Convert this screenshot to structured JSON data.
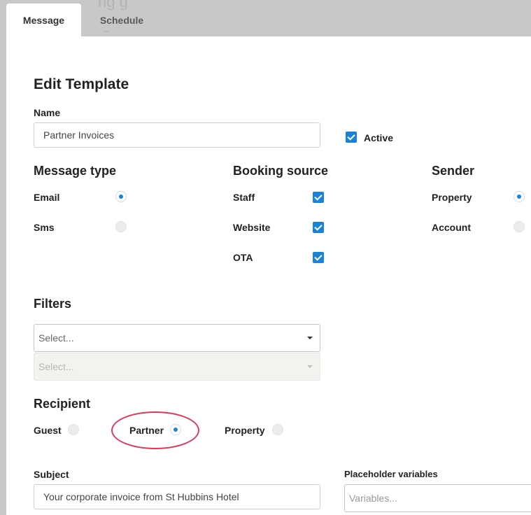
{
  "tabs": [
    {
      "label": "Message"
    },
    {
      "label": "Schedule"
    }
  ],
  "heading": "Edit Template",
  "name": {
    "label": "Name",
    "value": "Partner Invoices"
  },
  "active": {
    "label": "Active",
    "checked": true
  },
  "message_type": {
    "title": "Message type",
    "options": [
      {
        "label": "Email",
        "selected": true
      },
      {
        "label": "Sms",
        "selected": false
      }
    ]
  },
  "booking_source": {
    "title": "Booking source",
    "options": [
      {
        "label": "Staff",
        "checked": true
      },
      {
        "label": "Website",
        "checked": true
      },
      {
        "label": "OTA",
        "checked": true
      }
    ]
  },
  "sender": {
    "title": "Sender",
    "options": [
      {
        "label": "Property",
        "selected": true
      },
      {
        "label": "Account",
        "selected": false
      }
    ]
  },
  "filters": {
    "title": "Filters",
    "select1_placeholder": "Select...",
    "select2_placeholder": "Select..."
  },
  "recipient": {
    "title": "Recipient",
    "options": [
      {
        "label": "Guest",
        "selected": false
      },
      {
        "label": "Partner",
        "selected": true
      },
      {
        "label": "Property",
        "selected": false
      }
    ]
  },
  "subject": {
    "label": "Subject",
    "value": "Your corporate invoice from St Hubbins Hotel"
  },
  "placeholder_variables": {
    "label": "Placeholder variables",
    "placeholder": "Variables..."
  },
  "colors": {
    "accent": "#1a83d6",
    "highlight": "#e0385c"
  }
}
